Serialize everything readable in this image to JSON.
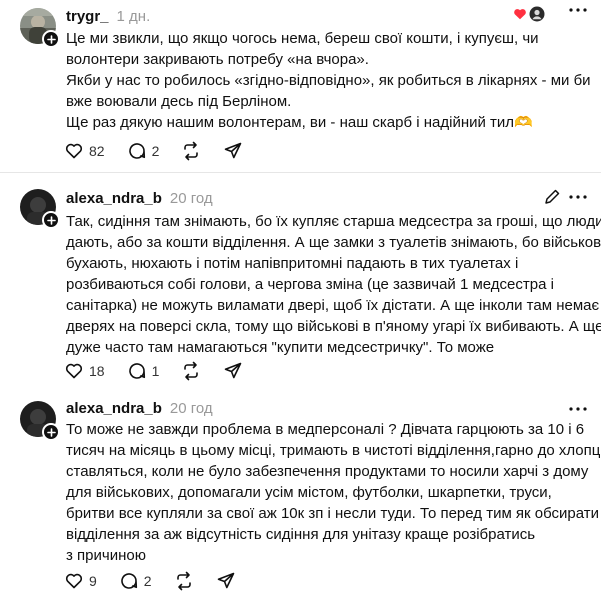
{
  "posts": [
    {
      "username": "trygr_",
      "time": "1 дн.",
      "lines": [
        "Це ми звикли, що якщо чогось нема, береш свої кошти, і купуєш, чи",
        "волонтери закривають потребу «на вчора».",
        "Якби у нас то робилось «згідно-відповідно», як робиться в лікарнях - ми би",
        "вже воювали десь під Берліном.",
        "Ще раз дякую нашим волонтерам, ви - наш скарб і надійний тил"
      ],
      "emoji": "🫶",
      "likes": "82",
      "replies": "2"
    },
    {
      "username": "alexa_ndra_b",
      "time": "20 год",
      "lines": [
        "Так, сидіння там знімають, бо їх купляє старша медсестра за гроші, що люди",
        "дають, або за кошти відділення. А ще замки з туалетів знімають, бо військові",
        "бухають, нюхають і потім напівпритомні падають в тих туалетах і",
        "розбиваються собі голови, а чергова зміна (це зазвичай 1 медсестра і",
        "санітарка) не можуть виламати двері, щоб їх дістати. А ще інколи там немає в",
        "дверях на поверсі скла, тому що військові в п'яному угарі їх вибивають. А ще",
        "дуже часто там намагаються \"купити медсестричку\". То може"
      ],
      "likes": "18",
      "replies": "1"
    },
    {
      "username": "alexa_ndra_b",
      "time": "20 год",
      "lines": [
        "То може не завжди проблема в медперсоналі ? Дівчата гарцюють за 10 і 6",
        "тисяч на місяць в цьому місці, тримають в чистоті відділення,гарно до хлопців",
        "ставляться, коли не було забезпечення продуктами то носили харчі з дому",
        "для військових, допомагали усім містом, футболки, шкарпетки, труси,",
        "бритви все купляли за свої аж 10к зп і несли туди. То перед тим як обсирати",
        "відділення за аж відсутність сидіння для унітазу краще розібратись",
        "з причиною"
      ],
      "likes": "9",
      "replies": "2"
    }
  ]
}
